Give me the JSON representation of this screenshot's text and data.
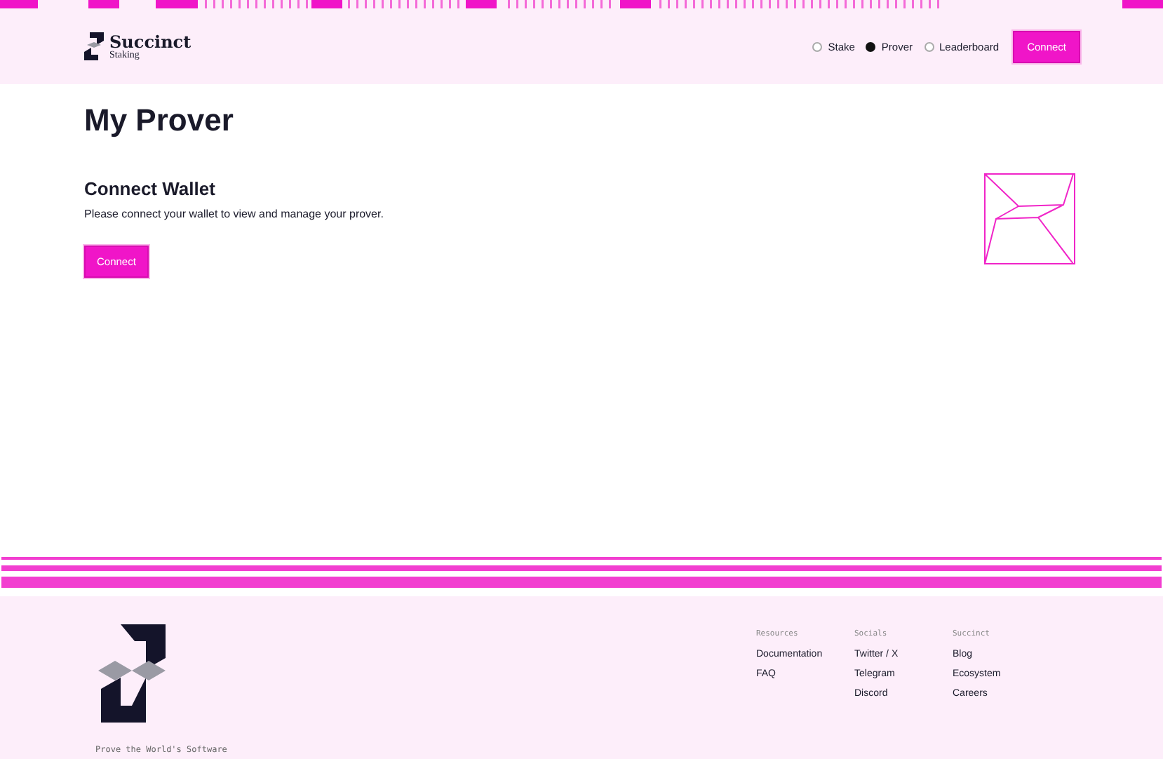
{
  "brand": {
    "name": "Succinct",
    "subtitle": "Staking"
  },
  "nav": [
    {
      "label": "Stake",
      "selected": false
    },
    {
      "label": "Prover",
      "selected": true
    },
    {
      "label": "Leaderboard",
      "selected": false
    }
  ],
  "header_button": "Connect",
  "page_title": "My Prover",
  "connect_card": {
    "title": "Connect Wallet",
    "message": "Please connect your wallet to view and manage your prover.",
    "button": "Connect"
  },
  "footer": {
    "tagline": "Prove the World's Software",
    "columns": [
      {
        "heading": "Resources",
        "links": [
          "Documentation",
          "FAQ"
        ]
      },
      {
        "heading": "Socials",
        "links": [
          "Twitter / X",
          "Telegram",
          "Discord"
        ]
      },
      {
        "heading": "Succinct",
        "links": [
          "Blog",
          "Ecosystem",
          "Careers"
        ]
      }
    ]
  }
}
